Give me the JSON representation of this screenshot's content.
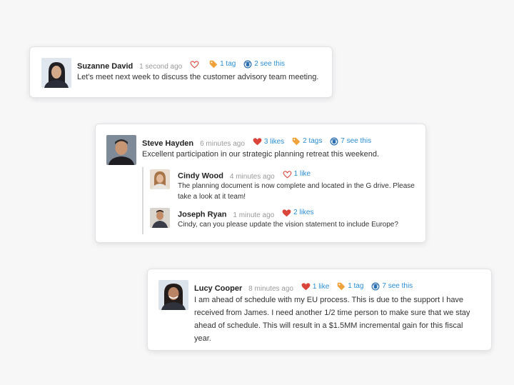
{
  "colors": {
    "heart": "#d9453a",
    "tag": "#f0a23a",
    "link": "#2b8ed2"
  },
  "posts": [
    {
      "author": "Suzanne David",
      "time": "1 second ago",
      "like_icon": "heart-outline-icon",
      "tags": "1 tag",
      "seen": "2 see this",
      "text": "Let's meet next week to discuss the customer advisory team meeting."
    },
    {
      "author": "Steve Hayden",
      "time": "6 minutes ago",
      "likes": "3 likes",
      "tags": "2 tags",
      "seen": "7 see this",
      "text": "Excellent participation in our strategic planning retreat this weekend.",
      "replies": [
        {
          "author": "Cindy Wood",
          "time": "4 minutes ago",
          "likes": "1 like",
          "text_line1": "The planning document is now complete and located in the G drive. Please",
          "text_line2": "take a look at it team!"
        },
        {
          "author": "Joseph Ryan",
          "time": "1 minute ago",
          "likes": "2 likes",
          "text_line1": "Cindy, can you please update the vision statement to include Europe?"
        }
      ]
    },
    {
      "author": "Lucy Cooper",
      "time": "8 minutes ago",
      "likes": "1 like",
      "tags": "1 tag",
      "seen": "7 see this",
      "text_lines": [
        "I am ahead of schedule with my EU process. This is due to the support I have",
        "received from James. I need another 1/2 time person to make sure that we stay",
        "ahead of schedule. This will result in a $1.5MM incremental gain for this fiscal",
        "year."
      ]
    }
  ]
}
